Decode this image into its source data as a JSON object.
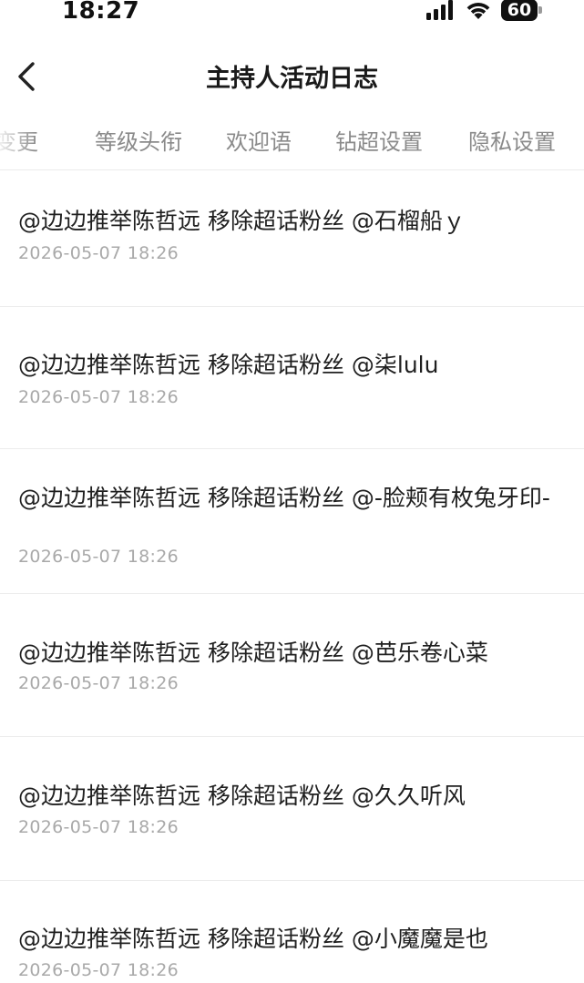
{
  "status_bar": {
    "time": "18:27",
    "battery": "60",
    "icons": [
      "signal-icon",
      "wifi-icon",
      "battery-icon"
    ]
  },
  "nav": {
    "title": "主持人活动日志",
    "back_icon": "chevron-left-icon"
  },
  "tabs": [
    {
      "label": "变更"
    },
    {
      "label": "等级头衔"
    },
    {
      "label": "欢迎语"
    },
    {
      "label": "钻超设置"
    },
    {
      "label": "隐私设置"
    }
  ],
  "logs": [
    {
      "text": "@边边推举陈哲远 移除超话粉丝 @石榴船ｙ",
      "time": "2026-05-07 18:26"
    },
    {
      "text": "@边边推举陈哲远 移除超话粉丝 @柒lulu",
      "time": "2026-05-07 18:26"
    },
    {
      "text": "@边边推举陈哲远 移除超话粉丝 @-脸颊有枚兔牙印-",
      "time": "2026-05-07 18:26"
    },
    {
      "text": "@边边推举陈哲远 移除超话粉丝 @芭乐卷心菜",
      "time": "2026-05-07 18:26"
    },
    {
      "text": "@边边推举陈哲远 移除超话粉丝 @久久听风",
      "time": "2026-05-07 18:26"
    },
    {
      "text": "@边边推举陈哲远 移除超话粉丝 @小魔魔是也",
      "time": "2026-05-07 18:26"
    }
  ]
}
